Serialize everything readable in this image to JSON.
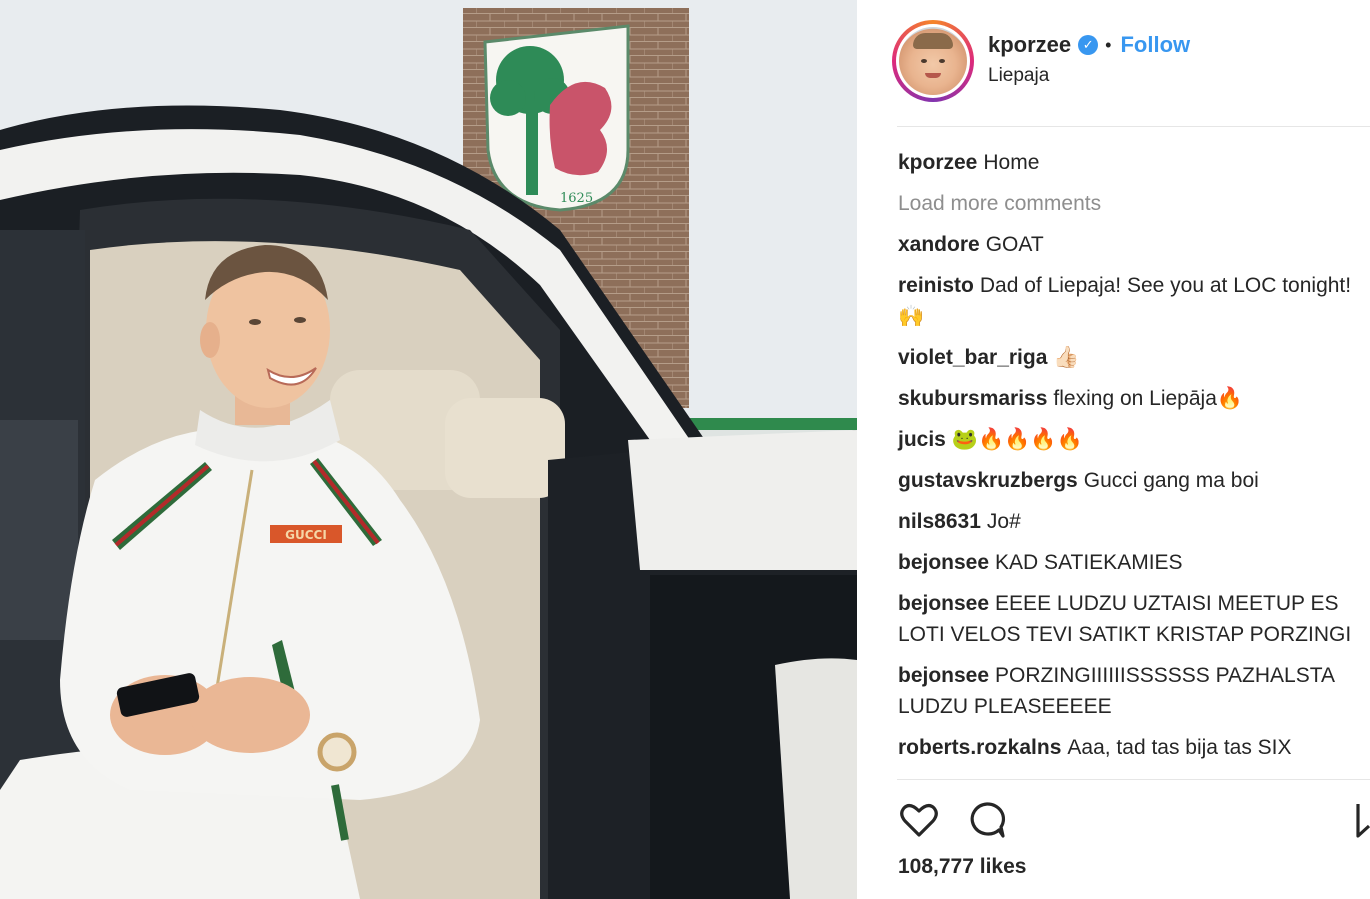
{
  "post": {
    "username": "kporzee",
    "verified_icon": "verified-badge-icon",
    "separator": "•",
    "follow_label": "Follow",
    "location": "Liepaja"
  },
  "photo": {
    "emblem_year": "1625",
    "jacket_brand": "GUCCI"
  },
  "comments": [
    {
      "user": "kporzee",
      "text": "Home"
    },
    {
      "type": "load-more",
      "text": "Load more comments"
    },
    {
      "user": "xandore",
      "text": "GOAT"
    },
    {
      "user": "reinisto",
      "text": "Dad of Liepaja! See you at LOC tonight! 🙌"
    },
    {
      "user": "violet_bar_riga",
      "text": "👍🏻"
    },
    {
      "user": "skubursmariss",
      "text": "flexing on Liepāja🔥"
    },
    {
      "user": "jucis",
      "text": "🐸🔥🔥🔥🔥"
    },
    {
      "user": "gustavskruzbergs",
      "text": "Gucci gang ma boi"
    },
    {
      "user": "nils8631",
      "text": "Jo#"
    },
    {
      "user": "bejonsee",
      "text": "KAD SATIEKAMIES"
    },
    {
      "user": "bejonsee",
      "text": "EEEE LUDZU UZTAISI MEETUP ES LOTI VELOS TEVI SATIKT KRISTAP PORZINGI"
    },
    {
      "user": "bejonsee",
      "text": "PORZINGIIIIIISSSSSS PAZHALSTA LUDZU PLEASEEEEE"
    },
    {
      "user": "roberts.rozkalns",
      "text": "Aaa, tad tas bija tas SIX"
    }
  ],
  "actions": {
    "like_icon": "heart-icon",
    "comment_icon": "comment-bubble-icon",
    "save_icon": "bookmark-icon"
  },
  "likes": "108,777 likes",
  "colors": {
    "accent": "#3897f0",
    "text": "#262626",
    "muted": "#8e8e8e",
    "divider": "#e6e6e6"
  }
}
